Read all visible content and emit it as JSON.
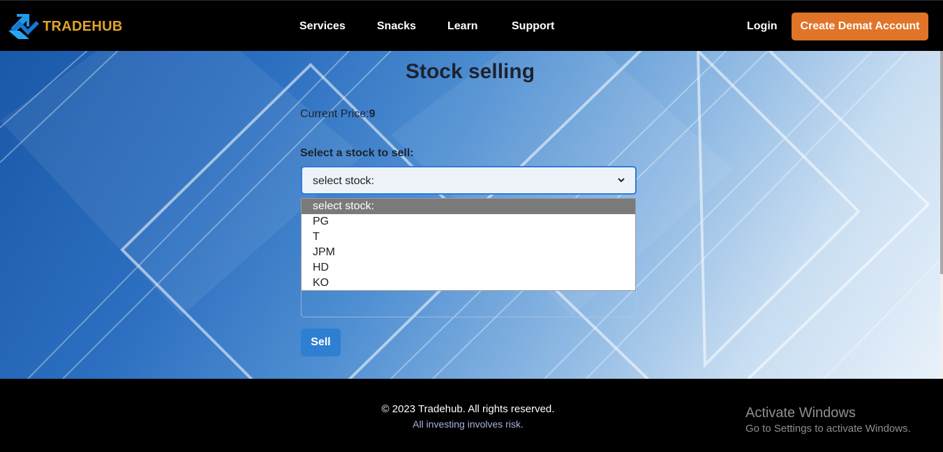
{
  "brand": {
    "name": "TRADEHUB",
    "color": "#e3a32c",
    "logo_icon": "blue-arrow-icon"
  },
  "nav": {
    "links": [
      "Services",
      "Snacks",
      "Learn",
      "Support"
    ],
    "login_label": "Login",
    "cta_label": "Create Demat Account",
    "cta_color": "#e07428"
  },
  "main": {
    "title": "Stock selling",
    "price_label": "Current Price:",
    "price_value": "9",
    "select_label": "Select a stock to sell:",
    "select_value": "select stock:",
    "select_accent": "#2f7bd6",
    "dropdown_options": [
      "select stock:",
      "PG",
      "T",
      "JPM",
      "HD",
      "KO"
    ],
    "dropdown_selected_index": 0,
    "quantity_value": "",
    "sell_label": "Sell",
    "sell_color": "#2e7fd2"
  },
  "footer": {
    "copyright": "© 2023 Tradehub. All rights reserved.",
    "risk": "All investing involves risk."
  },
  "watermark": {
    "title": "Activate Windows",
    "subtitle": "Go to Settings to activate Windows."
  }
}
